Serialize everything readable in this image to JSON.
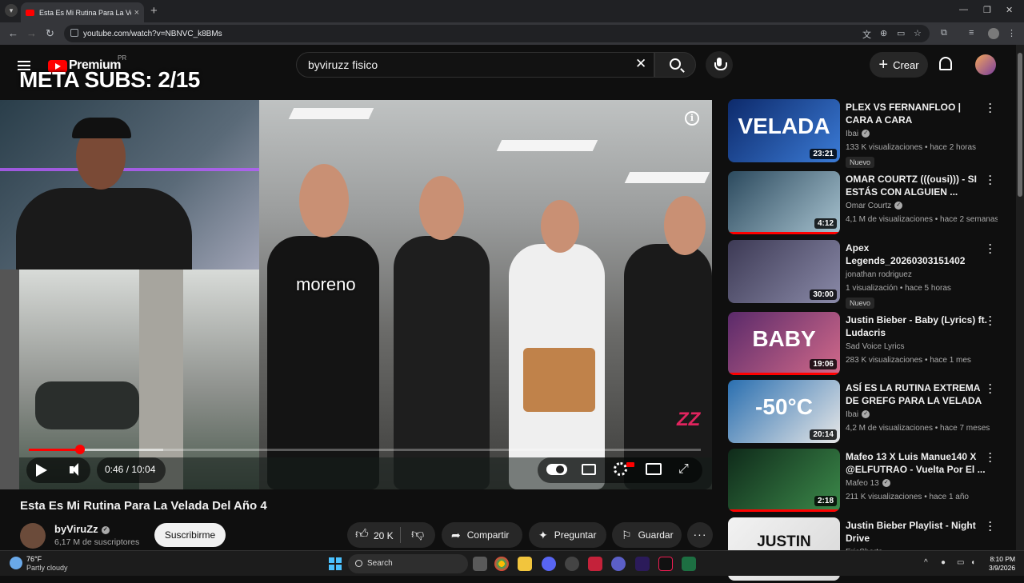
{
  "browser": {
    "tab_title": "Esta Es Mi Rutina Para La Velada",
    "url": "youtube.com/watch?v=NBNVC_k8BMs"
  },
  "header": {
    "brand": "Premium",
    "region": "PR",
    "search_value": "byviruzz fisico",
    "create_label": "Crear"
  },
  "overlay_text": "META SUBS: 2/15",
  "player": {
    "caption_name": "moreno",
    "time": "0:46 / 10:04",
    "progress_fraction": 0.076,
    "buffer_fraction": 0.2,
    "watermark": "ZZ"
  },
  "video": {
    "title": "Esta Es Mi Rutina Para La Velada Del Año 4",
    "channel": "byViruZz",
    "subscribers": "6,17 M de suscriptores",
    "subscribe_label": "Suscribirme",
    "likes": "20 K",
    "share_label": "Compartir",
    "ask_label": "Preguntar",
    "save_label": "Guardar"
  },
  "sidebar": {
    "new_label": "Nuevo",
    "items": [
      {
        "title": "PLEX VS FERNANFLOO | CARA A CARA",
        "channel": "Ibai",
        "verified": true,
        "meta": "133 K visualizaciones • hace 2 horas",
        "duration": "23:21",
        "is_new": true,
        "thumb_text": "VELADA",
        "thumb_colors": [
          "#0d2a6b",
          "#3b7bd6"
        ],
        "progress": 0
      },
      {
        "title": "OMAR COURTZ (((ousi))) - SI ESTÁS CON ALGUIEN ...",
        "channel": "Omar Courtz",
        "verified": true,
        "meta": "4,1 M de visualizaciones • hace 2 semanas",
        "duration": "4:12",
        "is_new": false,
        "thumb_text": "",
        "thumb_colors": [
          "#2c4a5e",
          "#a7c2cf"
        ],
        "progress": 1
      },
      {
        "title": "Apex Legends_20260303151402",
        "channel": "jonathan rodriguez",
        "verified": false,
        "meta": "1 visualización • hace 5 horas",
        "duration": "30:00",
        "is_new": true,
        "thumb_text": "",
        "thumb_colors": [
          "#3d3a55",
          "#8a8aa8"
        ],
        "progress": 0
      },
      {
        "title": "Justin Bieber - Baby (Lyrics) ft. Ludacris",
        "channel": "Sad Voice Lyrics",
        "verified": false,
        "meta": "283 K visualizaciones • hace 1 mes",
        "duration": "19:06",
        "is_new": false,
        "thumb_text": "BABY",
        "thumb_colors": [
          "#5a2a6a",
          "#d26a8a"
        ],
        "progress": 1
      },
      {
        "title": "ASÍ ES LA RUTINA EXTREMA DE GREFG PARA LA VELADA",
        "channel": "Ibai",
        "verified": true,
        "meta": "4,2 M de visualizaciones • hace 7 meses",
        "duration": "20:14",
        "is_new": false,
        "thumb_text": "-50°C",
        "thumb_colors": [
          "#2a6fb0",
          "#e7e7e7"
        ],
        "progress": 0
      },
      {
        "title": "Mafeo 13 X Luis Manue140 X @ELFUTRAO - Vuelta Por El ...",
        "channel": "Mafeo 13",
        "verified": true,
        "meta": "211 K visualizaciones • hace 1 año",
        "duration": "2:18",
        "is_new": false,
        "thumb_text": "",
        "thumb_colors": [
          "#0f2a1a",
          "#3c8a4a"
        ],
        "progress": 1
      },
      {
        "title": "Justin Bieber Playlist - Night Drive",
        "channel": "EricShorts",
        "verified": false,
        "meta": "",
        "duration": "",
        "is_new": false,
        "thumb_text": "JUSTIN BIEBER",
        "thumb_colors": [
          "#f2f2f2",
          "#d8d8d8"
        ],
        "progress": 0
      }
    ]
  },
  "taskbar": {
    "temperature": "76°F",
    "condition": "Partly cloudy",
    "search_label": "Search",
    "time": "8:10 PM",
    "date": "3/9/2026"
  },
  "colors": {
    "accent": "#ff0000",
    "background": "#0f0f0f"
  }
}
